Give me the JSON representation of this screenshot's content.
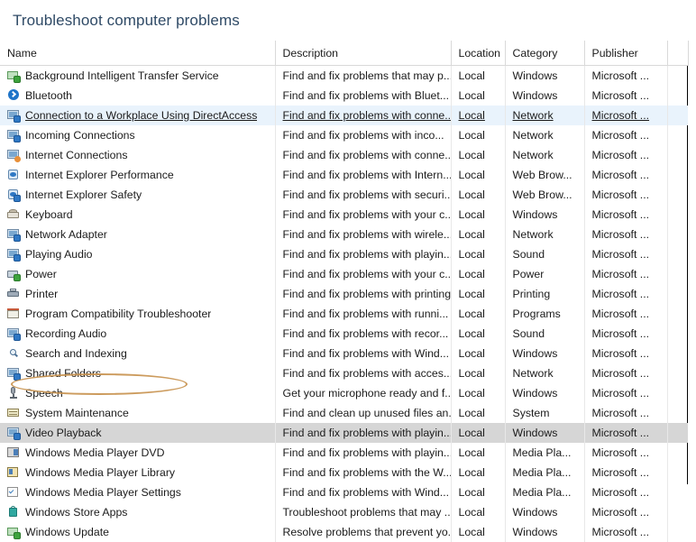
{
  "window": {
    "title": "Troubleshoot computer problems"
  },
  "colors": {
    "title_text": "#2f4a66",
    "hover_row_bg": "#e9f3fc",
    "selected_row_bg": "#d6d6d6",
    "annotation_oval": "#c8924f",
    "grid_line": "#e8e8e8",
    "header_line": "#d9d9d9"
  },
  "table": {
    "columns": [
      {
        "key": "name",
        "label": "Name"
      },
      {
        "key": "description",
        "label": "Description"
      },
      {
        "key": "location",
        "label": "Location"
      },
      {
        "key": "category",
        "label": "Category"
      },
      {
        "key": "publisher",
        "label": "Publisher"
      }
    ],
    "rows": [
      {
        "icon": "background-transfer-icon",
        "name": "Background Intelligent Transfer Service",
        "description": "Find and fix problems that may p...",
        "location": "Local",
        "category": "Windows",
        "publisher": "Microsoft ...",
        "state": "normal"
      },
      {
        "icon": "bluetooth-icon",
        "name": "Bluetooth",
        "description": "Find and fix problems with Bluet...",
        "location": "Local",
        "category": "Windows",
        "publisher": "Microsoft ...",
        "state": "normal"
      },
      {
        "icon": "directaccess-icon",
        "name": "Connection to a Workplace Using DirectAccess",
        "description": "Find and fix problems with conne...",
        "location": "Local",
        "category": "Network",
        "publisher": "Microsoft ...",
        "state": "hover"
      },
      {
        "icon": "incoming-connections-icon",
        "name": "Incoming Connections",
        "description": "Find and fix problems with inco...",
        "location": "Local",
        "category": "Network",
        "publisher": "Microsoft ...",
        "state": "normal"
      },
      {
        "icon": "internet-connections-icon",
        "name": "Internet Connections",
        "description": "Find and fix problems with conne...",
        "location": "Local",
        "category": "Network",
        "publisher": "Microsoft ...",
        "state": "normal"
      },
      {
        "icon": "ie-performance-icon",
        "name": "Internet Explorer Performance",
        "description": "Find and fix problems with Intern...",
        "location": "Local",
        "category": "Web Brow...",
        "publisher": "Microsoft ...",
        "state": "normal"
      },
      {
        "icon": "ie-safety-icon",
        "name": "Internet Explorer Safety",
        "description": "Find and fix problems with securi...",
        "location": "Local",
        "category": "Web Brow...",
        "publisher": "Microsoft ...",
        "state": "normal"
      },
      {
        "icon": "keyboard-icon",
        "name": "Keyboard",
        "description": "Find and fix problems with your c...",
        "location": "Local",
        "category": "Windows",
        "publisher": "Microsoft ...",
        "state": "normal"
      },
      {
        "icon": "network-adapter-icon",
        "name": "Network Adapter",
        "description": "Find and fix problems with wirele...",
        "location": "Local",
        "category": "Network",
        "publisher": "Microsoft ...",
        "state": "normal"
      },
      {
        "icon": "playing-audio-icon",
        "name": "Playing Audio",
        "description": "Find and fix problems with playin...",
        "location": "Local",
        "category": "Sound",
        "publisher": "Microsoft ...",
        "state": "normal"
      },
      {
        "icon": "power-icon",
        "name": "Power",
        "description": "Find and fix problems with your c...",
        "location": "Local",
        "category": "Power",
        "publisher": "Microsoft ...",
        "state": "normal"
      },
      {
        "icon": "printer-icon",
        "name": "Printer",
        "description": "Find and fix problems with printing",
        "location": "Local",
        "category": "Printing",
        "publisher": "Microsoft ...",
        "state": "normal"
      },
      {
        "icon": "program-compatibility-icon",
        "name": "Program Compatibility Troubleshooter",
        "description": "Find and fix problems with runni...",
        "location": "Local",
        "category": "Programs",
        "publisher": "Microsoft ...",
        "state": "normal"
      },
      {
        "icon": "recording-audio-icon",
        "name": "Recording Audio",
        "description": "Find and fix problems with recor...",
        "location": "Local",
        "category": "Sound",
        "publisher": "Microsoft ...",
        "state": "normal"
      },
      {
        "icon": "search-indexing-icon",
        "name": "Search and Indexing",
        "description": "Find and fix problems with Wind...",
        "location": "Local",
        "category": "Windows",
        "publisher": "Microsoft ...",
        "state": "normal"
      },
      {
        "icon": "shared-folders-icon",
        "name": "Shared Folders",
        "description": "Find and fix problems with acces...",
        "location": "Local",
        "category": "Network",
        "publisher": "Microsoft ...",
        "state": "normal"
      },
      {
        "icon": "speech-icon",
        "name": "Speech",
        "description": "Get your microphone ready and f...",
        "location": "Local",
        "category": "Windows",
        "publisher": "Microsoft ...",
        "state": "normal"
      },
      {
        "icon": "system-maintenance-icon",
        "name": "System Maintenance",
        "description": "Find and clean up unused files an...",
        "location": "Local",
        "category": "System",
        "publisher": "Microsoft ...",
        "state": "normal"
      },
      {
        "icon": "video-playback-icon",
        "name": "Video Playback",
        "description": "Find and fix problems with playin...",
        "location": "Local",
        "category": "Windows",
        "publisher": "Microsoft ...",
        "state": "selected"
      },
      {
        "icon": "wmp-dvd-icon",
        "name": "Windows Media Player DVD",
        "description": "Find and fix problems with playin...",
        "location": "Local",
        "category": "Media Pla...",
        "publisher": "Microsoft ...",
        "state": "normal"
      },
      {
        "icon": "wmp-library-icon",
        "name": "Windows Media Player Library",
        "description": "Find and fix problems with the W...",
        "location": "Local",
        "category": "Media Pla...",
        "publisher": "Microsoft ...",
        "state": "normal"
      },
      {
        "icon": "wmp-settings-icon",
        "name": "Windows Media Player Settings",
        "description": "Find and fix problems with Wind...",
        "location": "Local",
        "category": "Media Pla...",
        "publisher": "Microsoft ...",
        "state": "normal"
      },
      {
        "icon": "windows-store-apps-icon",
        "name": "Windows Store Apps",
        "description": "Troubleshoot problems that may ...",
        "location": "Local",
        "category": "Windows",
        "publisher": "Microsoft ...",
        "state": "normal"
      },
      {
        "icon": "windows-update-icon",
        "name": "Windows Update",
        "description": "Resolve problems that prevent yo...",
        "location": "Local",
        "category": "Windows",
        "publisher": "Microsoft ...",
        "state": "normal"
      }
    ]
  },
  "annotation": {
    "target_row_name": "Video Playback",
    "shape": "ellipse",
    "color": "#c8924f"
  }
}
